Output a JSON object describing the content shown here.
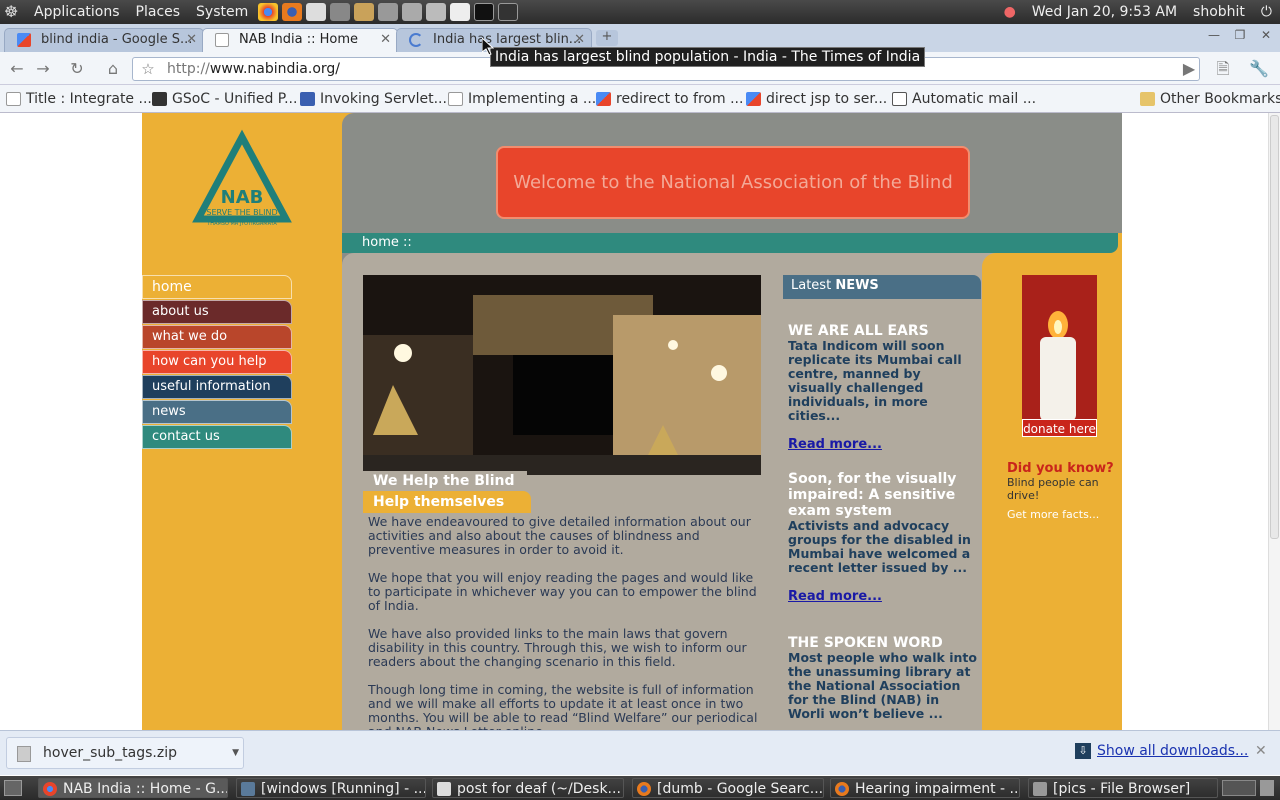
{
  "panel": {
    "menus": [
      "Applications",
      "Places",
      "System"
    ],
    "clock": "Wed Jan 20,  9:53 AM",
    "user": "shobhit"
  },
  "tabs": [
    {
      "title": "blind india - Google S...",
      "active": false
    },
    {
      "title": "NAB India :: Home",
      "active": true
    },
    {
      "title": "India has largest blin...",
      "active": false
    }
  ],
  "tooltip": "India has largest blind population - India - The Times of India",
  "address": {
    "scheme": "http://",
    "host": "www.nabindia.org/"
  },
  "bookmarks": [
    "Title : Integrate ...",
    "GSoC - Unified P...",
    "Invoking Servlet...",
    "Implementing a ...",
    "redirect to from ...",
    "direct jsp to ser...",
    "Automatic mail ...",
    "Other Bookmarks"
  ],
  "site": {
    "logo_text": "NAB",
    "logo_tagline": "SERVE THE BLIND",
    "logo_sub": "THAMSO MA JYOTIRGAMAYA",
    "welcome": "Welcome to the National Association of the Blind",
    "breadcrumb": "home ::",
    "nav": [
      {
        "label": "home",
        "color": "#ecb035"
      },
      {
        "label": "about us",
        "color": "#6b2a2a"
      },
      {
        "label": "what we do",
        "color": "#b9462b"
      },
      {
        "label": "how can you help",
        "color": "#e8452b"
      },
      {
        "label": "useful information",
        "color": "#1f3f5d"
      },
      {
        "label": "news",
        "color": "#4a6f86"
      },
      {
        "label": "contact us",
        "color": "#2f8a7e"
      }
    ],
    "subhead1": "We Help the Blind",
    "subhead2": "Help themselves",
    "paragraphs": [
      "We have endeavoured to give detailed information about our activities and also about the causes of blindness and preventive measures in order to avoid it.",
      "We hope that you will enjoy reading the pages and would like to participate in whichever way you can to empower the blind of India.",
      "We have also provided links to the main laws that govern disability in this country.  Through this, we wish to inform our readers about the changing scenario in this field.",
      "Though long time in coming, the website is full of information and we will make all efforts to update it at least once in two months.  You will be able to read “Blind Welfare” our periodical and NAB News Letter online."
    ],
    "news_head_prefix": "Latest",
    "news_head_bold": "NEWS",
    "news": [
      {
        "title": "WE ARE ALL EARS",
        "body": "Tata Indicom will soon replicate its Mumbai call centre, manned by visually challenged individuals, in more cities...",
        "link": "Read more..."
      },
      {
        "title": "Soon, for the visually impaired: A sensitive exam system",
        "body": "Activists and advocacy groups for the disabled in Mumbai have welcomed a recent letter issued by ...",
        "link": "Read more..."
      },
      {
        "title": "THE SPOKEN WORD",
        "body": "Most people who walk into the unassuming library at the National Association for the Blind (NAB) in Worli won’t believe ...",
        "link": ""
      }
    ],
    "donate": "donate here",
    "did_you_know_title": "Did you know?",
    "did_you_know_body": "Blind people can drive!",
    "more_facts": "Get more facts..."
  },
  "download": {
    "file": "hover_sub_tags.zip",
    "show_all": "Show all downloads..."
  },
  "taskbar": [
    "NAB India :: Home - G...",
    "[windows [Running] - ...",
    "post for deaf (~/Desk...",
    "[dumb - Google Searc...",
    "Hearing impairment - ...",
    "[pics - File Browser]"
  ]
}
